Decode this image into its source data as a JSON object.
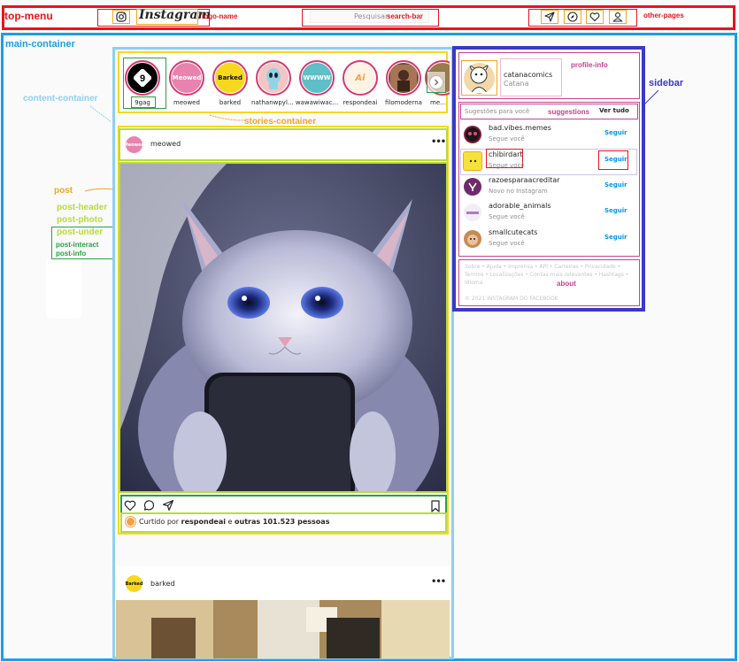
{
  "top_menu": {
    "label": "top-menu",
    "logo_text": "Instagram",
    "logo_label": "logo-name",
    "search_placeholder": "Pesquisar",
    "search_label": "search-bar",
    "other_pages_label": "other-pages",
    "icons": [
      "instagram-icon",
      "direct-icon",
      "explore-icon",
      "heart-icon",
      "profile-icon"
    ]
  },
  "main": {
    "label": "main-container",
    "content_label": "content-container",
    "stories_label": "stories-container",
    "post_label": "post",
    "post_parts": {
      "header": "post-header",
      "photo": "post-photo",
      "under": "post-under",
      "interact": "post-interact",
      "info": "post-info"
    }
  },
  "stories": [
    {
      "name": "9gag",
      "avatar_text": "9",
      "color": "#000000"
    },
    {
      "name": "meowed",
      "avatar_text": "Meowed",
      "color": "#e883b0"
    },
    {
      "name": "barked",
      "avatar_text": "Barked",
      "color": "#f7d81d"
    },
    {
      "name": "nathanwpyle...",
      "avatar_text": "",
      "color": "#8fd3e6"
    },
    {
      "name": "wawawiwac...",
      "avatar_text": "WWWW",
      "color": "#5fbfc6"
    },
    {
      "name": "respondeai",
      "avatar_text": "Ai",
      "color": "#f4a041"
    },
    {
      "name": "filomoderna",
      "avatar_text": "",
      "color": "#6b4a3a"
    },
    {
      "name": "meme",
      "avatar_text": "",
      "color": "#9b7b4b"
    }
  ],
  "posts": [
    {
      "user": "meowed",
      "avatar_text": "Meowed",
      "avatar_color": "#e883b0",
      "liked_by_prefix": "Curtido por",
      "liked_by_user": "respondeai",
      "liked_by_middle": "e",
      "liked_by_others": "outras 101.523 pessoas"
    },
    {
      "user": "barked",
      "avatar_text": "Barked",
      "avatar_color": "#f7d81d"
    }
  ],
  "sidebar": {
    "label": "sidebar",
    "profile_label": "profile-info",
    "profile_user": "catanacomics",
    "profile_name": "Catana",
    "suggestions_title": "Sugestões para você",
    "suggestions_label": "suggestions",
    "see_all": "Ver tudo",
    "suggestions": [
      {
        "user": "bad.vibes.memes",
        "sub": "Segue você",
        "follow": "Seguir",
        "color": "#7a1f3c"
      },
      {
        "user": "chibirdart",
        "sub": "Segue você",
        "follow": "Seguir",
        "color": "#f5e23a"
      },
      {
        "user": "razoesparaacreditar",
        "sub": "Novo no Instagram",
        "follow": "Seguir",
        "color": "#6e2a6a"
      },
      {
        "user": "adorable_animals",
        "sub": "Segue você",
        "follow": "Seguir",
        "color": "#f3eef5"
      },
      {
        "user": "smallcutecats",
        "sub": "Segue você",
        "follow": "Seguir",
        "color": "#c78a52"
      }
    ],
    "about_links": "Sobre • Ajuda • Imprensa • API • Carreiras • Privacidade • Termos • Localizações • Contas mais relevantes • Hashtags • Idioma",
    "about_label": "about",
    "copyright": "© 2021 INSTAGRAM DO FACEBOOK"
  },
  "colors": {
    "top_menu_border": "#e8141c",
    "main_border": "#1c9ee6",
    "content_border": "#8fcfee",
    "sidebar_border": "#3b38c8",
    "accent_blue": "#0095f6"
  }
}
